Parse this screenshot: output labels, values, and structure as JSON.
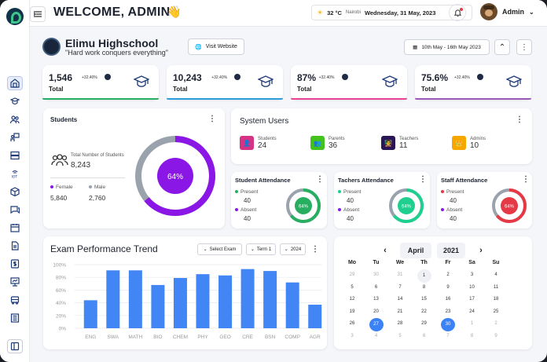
{
  "header": {
    "welcome": "WELCOME, ADMIN",
    "wave_emoji": "👋",
    "temperature": "32 °C",
    "city": "Nairobi",
    "date": "Wednesday, 31 May, 2023",
    "user": "Admin"
  },
  "school": {
    "name": "Elimu Highschool",
    "motto": "\"Hard work conquers everything\"",
    "visit_label": "Visit Website",
    "date_range": "10th May - 16th May 2023"
  },
  "stats": [
    {
      "value": "1,546",
      "change": "+32.40%",
      "label": "Total",
      "accent": "#27ae60"
    },
    {
      "value": "10,243",
      "change": "+32.40%",
      "label": "Total",
      "accent": "#2d9cdb"
    },
    {
      "value": "87%",
      "change": "+32.40%",
      "label": "Total",
      "accent": "#e84393"
    },
    {
      "value": "75.6%",
      "change": "+32.40%",
      "label": "Total",
      "accent": "#9b59b6"
    }
  ],
  "students": {
    "title": "Students",
    "total_label": "Total Number of Students",
    "total": "8,243",
    "female_label": "Female",
    "male_label": "Male",
    "female": "5,840",
    "male": "2,760",
    "percent_label": "64%",
    "female_share": 0.64
  },
  "system_users": {
    "title": "System Users",
    "items": [
      {
        "label": "Students",
        "count": "24",
        "color": "#d63384"
      },
      {
        "label": "Parents",
        "count": "36",
        "color": "#44c21c"
      },
      {
        "label": "Teachers",
        "count": "11",
        "color": "#2a1556"
      },
      {
        "label": "Admins",
        "count": "10",
        "color": "#f5a700"
      }
    ]
  },
  "attendance": [
    {
      "title": "Student Attendance",
      "present_label": "Present",
      "absent_label": "Absent",
      "present": "40",
      "absent": "40",
      "percent": "64%",
      "level": 0.64,
      "color": "#27ae60"
    },
    {
      "title": "Tachers  Attendance",
      "present_label": "Present",
      "absent_label": "Absent",
      "present": "40",
      "absent": "40",
      "percent": "64%",
      "level": 0.64,
      "color": "#1fcf8f"
    },
    {
      "title": "Staff  Attendance",
      "present_label": "Present",
      "absent_label": "Absent",
      "present": "40",
      "absent": "40",
      "percent": "64%",
      "level": 0.64,
      "color": "#e63946"
    }
  ],
  "exam_filters": {
    "exam": "Select Exam",
    "term": "Term 1",
    "year": "2024"
  },
  "chart_data": {
    "type": "bar",
    "title": "Exam Performance Trend",
    "categories": [
      "ENG",
      "SWA",
      "MATH",
      "BIO",
      "CHEM",
      "PHY",
      "GEO",
      "CRE",
      "BSN",
      "COMP",
      "AGR"
    ],
    "values": [
      44,
      91,
      91,
      68,
      79,
      85,
      83,
      93,
      90,
      72,
      37
    ],
    "ylim": [
      0,
      100
    ],
    "yticks": [
      "0%",
      "20%",
      "40%",
      "60%",
      "80%",
      "100%"
    ],
    "color": "#4285f4",
    "grid": true
  },
  "calendar": {
    "month": "April",
    "year": "2021",
    "weekdays": [
      "Mo",
      "Tu",
      "We",
      "Th",
      "Fr",
      "Sa",
      "Su"
    ],
    "weeks": [
      [
        "29",
        "30",
        "31",
        "1",
        "2",
        "3",
        "4"
      ],
      [
        "5",
        "6",
        "7",
        "8",
        "9",
        "10",
        "11"
      ],
      [
        "12",
        "13",
        "14",
        "15",
        "16",
        "17",
        "18"
      ],
      [
        "19",
        "20",
        "21",
        "22",
        "23",
        "24",
        "25"
      ],
      [
        "26",
        "27",
        "28",
        "29",
        "30",
        "1",
        "2"
      ],
      [
        "3",
        "4",
        "5",
        "6",
        "7",
        "8",
        "9"
      ]
    ],
    "selected": [
      "27",
      "30"
    ],
    "today": "1"
  }
}
